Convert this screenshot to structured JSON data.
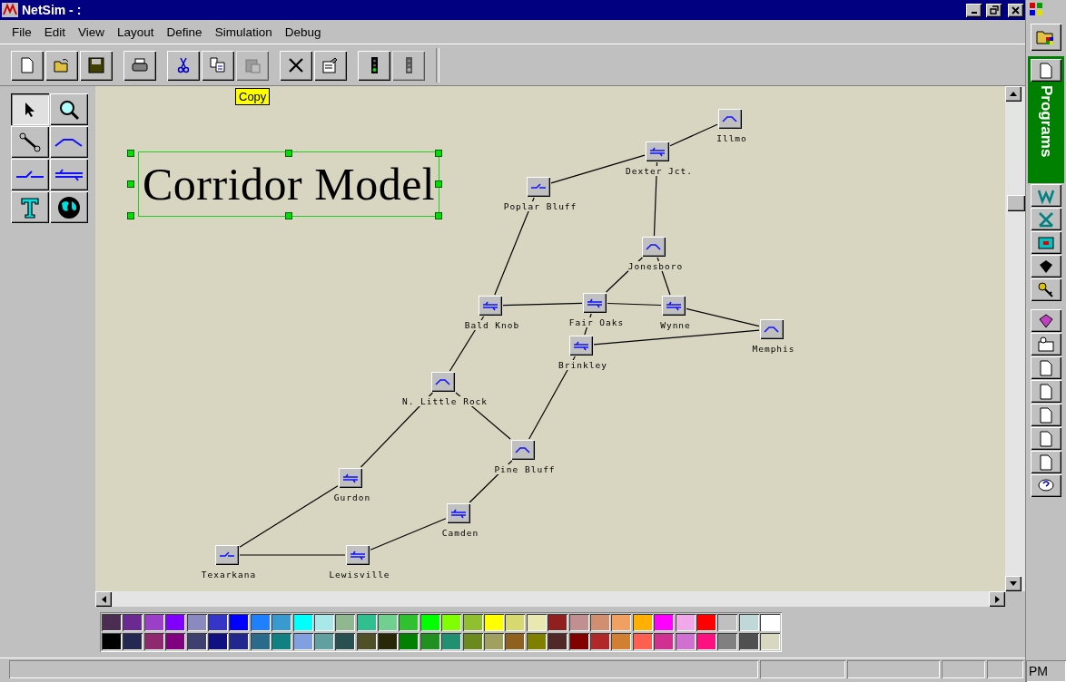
{
  "window": {
    "title": "NetSim - :"
  },
  "menu": [
    "File",
    "Edit",
    "View",
    "Layout",
    "Define",
    "Simulation",
    "Debug"
  ],
  "toolbar_groups": [
    {
      "buttons": [
        {
          "kind": "new",
          "disabled": false
        },
        {
          "kind": "open",
          "disabled": false
        },
        {
          "kind": "save",
          "disabled": false
        }
      ]
    },
    {
      "buttons": [
        {
          "kind": "print",
          "disabled": false
        }
      ]
    },
    {
      "buttons": [
        {
          "kind": "cut",
          "disabled": false
        },
        {
          "kind": "copy",
          "disabled": false
        },
        {
          "kind": "paste",
          "disabled": true
        }
      ]
    },
    {
      "buttons": [
        {
          "kind": "delete",
          "disabled": false
        },
        {
          "kind": "properties",
          "disabled": false
        }
      ]
    },
    {
      "buttons": [
        {
          "kind": "signal",
          "disabled": false
        },
        {
          "kind": "signal",
          "disabled": true
        }
      ]
    }
  ],
  "tooltip": {
    "text": "Copy"
  },
  "tools": [
    {
      "kind": "pointer",
      "selected": true
    },
    {
      "kind": "zoom",
      "selected": false
    },
    {
      "kind": "link",
      "selected": false
    },
    {
      "kind": "curve",
      "selected": false
    },
    {
      "kind": "switch",
      "selected": false
    },
    {
      "kind": "crossover",
      "selected": false
    },
    {
      "kind": "text",
      "selected": false
    },
    {
      "kind": "globe",
      "selected": false
    }
  ],
  "canvas": {
    "title_box": {
      "text": "Corridor Model",
      "selected": true
    },
    "nodes": [
      {
        "label": "Illmo",
        "kind": "curve"
      },
      {
        "label": "Dexter Jct.",
        "kind": "crossover"
      },
      {
        "label": "Poplar Bluff",
        "kind": "switch"
      },
      {
        "label": "Jonesboro",
        "kind": "curve"
      },
      {
        "label": "Bald Knob",
        "kind": "crossover"
      },
      {
        "label": "Fair Oaks",
        "kind": "crossover"
      },
      {
        "label": "Wynne",
        "kind": "crossover"
      },
      {
        "label": "Memphis",
        "kind": "curve"
      },
      {
        "label": "Brinkley",
        "kind": "crossover"
      },
      {
        "label": "N. Little Rock",
        "kind": "curve"
      },
      {
        "label": "Pine Bluff",
        "kind": "curve"
      },
      {
        "label": "Gurdon",
        "kind": "crossover"
      },
      {
        "label": "Camden",
        "kind": "crossover"
      },
      {
        "label": "Texarkana",
        "kind": "switch"
      },
      {
        "label": "Lewisville",
        "kind": "crossover"
      }
    ]
  },
  "palette_rows": [
    {
      "swatches": [
        {
          "color": "#4b2d52"
        },
        {
          "color": "#6a2a8f"
        },
        {
          "color": "#9b3fc9"
        },
        {
          "color": "#8000ff"
        },
        {
          "color": "#8a8ac0"
        },
        {
          "color": "#3535c8"
        },
        {
          "color": "#0000ff"
        },
        {
          "color": "#1e7fff"
        },
        {
          "color": "#3a9ad0"
        },
        {
          "color": "#00ffff"
        },
        {
          "color": "#a8e8e8"
        },
        {
          "color": "#90b890"
        },
        {
          "color": "#30c090"
        },
        {
          "color": "#70d090"
        },
        {
          "color": "#30c030"
        },
        {
          "color": "#00ff00"
        },
        {
          "color": "#80ff00"
        },
        {
          "color": "#90c030"
        },
        {
          "color": "#ffff00"
        },
        {
          "color": "#d8d870"
        },
        {
          "color": "#e8e8b0"
        },
        {
          "color": "#902020"
        },
        {
          "color": "#c09090"
        },
        {
          "color": "#d09070"
        },
        {
          "color": "#f0a060"
        },
        {
          "color": "#ffb000"
        },
        {
          "color": "#ff00ff"
        },
        {
          "color": "#f0a8e8"
        },
        {
          "color": "#ff0000"
        },
        {
          "color": "#c0c0c0"
        },
        {
          "color": "#c0d8d8"
        },
        {
          "color": "#ffffff"
        }
      ]
    },
    {
      "swatches": [
        {
          "color": "#000000"
        },
        {
          "color": "#252850"
        },
        {
          "color": "#902870"
        },
        {
          "color": "#800080"
        },
        {
          "color": "#404070"
        },
        {
          "color": "#101080"
        },
        {
          "color": "#202890"
        },
        {
          "color": "#2a6a8a"
        },
        {
          "color": "#108080"
        },
        {
          "color": "#80a0e0"
        },
        {
          "color": "#60a0a0"
        },
        {
          "color": "#285050"
        },
        {
          "color": "#505028"
        },
        {
          "color": "#282808"
        },
        {
          "color": "#008000"
        },
        {
          "color": "#209020"
        },
        {
          "color": "#209070"
        },
        {
          "color": "#6a8a20"
        },
        {
          "color": "#a0a060"
        },
        {
          "color": "#906020"
        },
        {
          "color": "#808000"
        },
        {
          "color": "#502828"
        },
        {
          "color": "#800000"
        },
        {
          "color": "#b02828"
        },
        {
          "color": "#d08030"
        },
        {
          "color": "#ff6050"
        },
        {
          "color": "#d03090"
        },
        {
          "color": "#d070d0"
        },
        {
          "color": "#ff1080"
        },
        {
          "color": "#808080"
        },
        {
          "color": "#505050"
        },
        {
          "color": "#d8d8c0"
        }
      ]
    }
  ],
  "shortcut_bar": {
    "title": "Programs"
  },
  "status_bar": {
    "clock": "PM"
  }
}
